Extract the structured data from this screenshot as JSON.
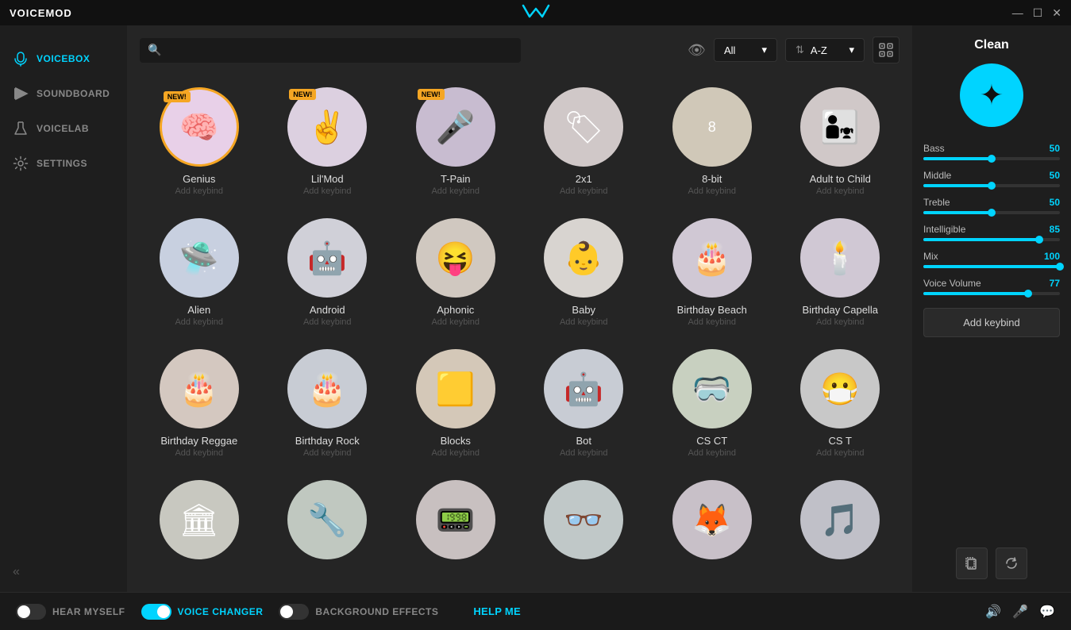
{
  "titlebar": {
    "app_name": "VOICEMOD",
    "logo_unicode": "ω",
    "minimize": "—",
    "maximize": "☐",
    "close": "✕"
  },
  "sidebar": {
    "items": [
      {
        "id": "voicebox",
        "label": "VOICEBOX",
        "icon": "🎤",
        "active": true
      },
      {
        "id": "soundboard",
        "label": "SOUNDBOARD",
        "icon": "⚡"
      },
      {
        "id": "voicelab",
        "label": "VOICELAB",
        "icon": "🔬"
      },
      {
        "id": "settings",
        "label": "SETTINGS",
        "icon": "⚙"
      }
    ],
    "collapse_icon": "«"
  },
  "search": {
    "placeholder": "",
    "filter_label": "All",
    "sort_label": "A-Z",
    "eye_icon": "👁",
    "sort_icon": "⇅"
  },
  "voices": [
    {
      "id": "genius",
      "name": "Genius",
      "keybind": "Add keybind",
      "emoji": "🧠",
      "bg": "#e8d0e8",
      "is_new": true,
      "selected": true
    },
    {
      "id": "lilmod",
      "name": "Lil'Mod",
      "keybind": "Add keybind",
      "emoji": "✌️",
      "bg": "#e8d0e8",
      "is_new": true
    },
    {
      "id": "tpain",
      "name": "T-Pain",
      "keybind": "Add keybind",
      "emoji": "🎤",
      "bg": "#c8c0d0",
      "is_new": true
    },
    {
      "id": "2x1",
      "name": "2x1",
      "keybind": "Add keybind",
      "emoji": "🏷",
      "bg": "#d8d0d0"
    },
    {
      "id": "8bit",
      "name": "8-bit",
      "keybind": "Add keybind",
      "emoji": "8",
      "bg": "#d8d0c0"
    },
    {
      "id": "adulttochild",
      "name": "Adult to Child",
      "keybind": "Add keybind",
      "emoji": "👨‍👧",
      "bg": "#d8d0d0"
    },
    {
      "id": "alien",
      "name": "Alien",
      "keybind": "Add keybind",
      "emoji": "🛸",
      "bg": "#d0d8e8"
    },
    {
      "id": "android",
      "name": "Android",
      "keybind": "Add keybind",
      "emoji": "🤖",
      "bg": "#d8d8e0"
    },
    {
      "id": "aphonic",
      "name": "Aphonic",
      "keybind": "Add keybind",
      "emoji": "😝",
      "bg": "#d0d0c8"
    },
    {
      "id": "baby",
      "name": "Baby",
      "keybind": "Add keybind",
      "emoji": "👶",
      "bg": "#d8d8d0"
    },
    {
      "id": "birthdaybeach",
      "name": "Birthday Beach",
      "keybind": "Add keybind",
      "emoji": "🎂",
      "bg": "#d0d0d8"
    },
    {
      "id": "birthdaycapella",
      "name": "Birthday Capella",
      "keybind": "Add keybind",
      "emoji": "🕯️",
      "bg": "#d0d0d8"
    },
    {
      "id": "birthdayreggae",
      "name": "Birthday Reggae",
      "keybind": "Add keybind",
      "emoji": "🎂",
      "bg": "#d8d0c8"
    },
    {
      "id": "birthdayrock",
      "name": "Birthday Rock",
      "keybind": "Add keybind",
      "emoji": "🎂",
      "bg": "#c8d0d8"
    },
    {
      "id": "blocks",
      "name": "Blocks",
      "keybind": "Add keybind",
      "emoji": "🟨",
      "bg": "#d0c8c0"
    },
    {
      "id": "bot",
      "name": "Bot",
      "keybind": "Add keybind",
      "emoji": "🤖",
      "bg": "#c8d0d8"
    },
    {
      "id": "csct",
      "name": "CS CT",
      "keybind": "Add keybind",
      "emoji": "🥽",
      "bg": "#c8d0c0"
    },
    {
      "id": "cst",
      "name": "CS T",
      "keybind": "Add keybind",
      "emoji": "😷",
      "bg": "#c8c8c8"
    },
    {
      "id": "r1",
      "name": "",
      "keybind": "",
      "emoji": "🏛",
      "bg": "#c8c8c0"
    },
    {
      "id": "r2",
      "name": "",
      "keybind": "",
      "emoji": "🔧",
      "bg": "#c0c8c0"
    },
    {
      "id": "r3",
      "name": "",
      "keybind": "",
      "emoji": "📟",
      "bg": "#c8c0c0"
    },
    {
      "id": "r4",
      "name": "",
      "keybind": "",
      "emoji": "👓",
      "bg": "#c0c8c8"
    },
    {
      "id": "r5",
      "name": "",
      "keybind": "",
      "emoji": "🦊",
      "bg": "#c8c0c8"
    },
    {
      "id": "r6",
      "name": "",
      "keybind": "",
      "emoji": "🎵",
      "bg": "#c0c0c8"
    }
  ],
  "right_panel": {
    "title": "Clean",
    "avatar_icon": "✦",
    "sliders": [
      {
        "id": "bass",
        "label": "Bass",
        "value": 50,
        "percent": 50
      },
      {
        "id": "middle",
        "label": "Middle",
        "value": 50,
        "percent": 50
      },
      {
        "id": "treble",
        "label": "Treble",
        "value": 50,
        "percent": 50
      },
      {
        "id": "intelligible",
        "label": "Intelligible",
        "value": 85,
        "percent": 85
      },
      {
        "id": "mix",
        "label": "Mix",
        "value": 100,
        "percent": 100
      },
      {
        "id": "voice_volume",
        "label": "Voice Volume",
        "value": 77,
        "percent": 77
      }
    ],
    "add_keybind": "Add keybind",
    "copy_icon": "⧉",
    "reset_icon": "↺"
  },
  "bottom_bar": {
    "hear_myself_label": "HEAR MYSELF",
    "hear_myself_on": false,
    "voice_changer_label": "VOICE CHANGER",
    "voice_changer_on": true,
    "background_effects_label": "BACKGROUND EFFECTS",
    "background_effects_on": false,
    "help_me_label": "HELP ME",
    "volume_icon": "🔊",
    "mic_icon": "🎤",
    "chat_icon": "💬"
  }
}
